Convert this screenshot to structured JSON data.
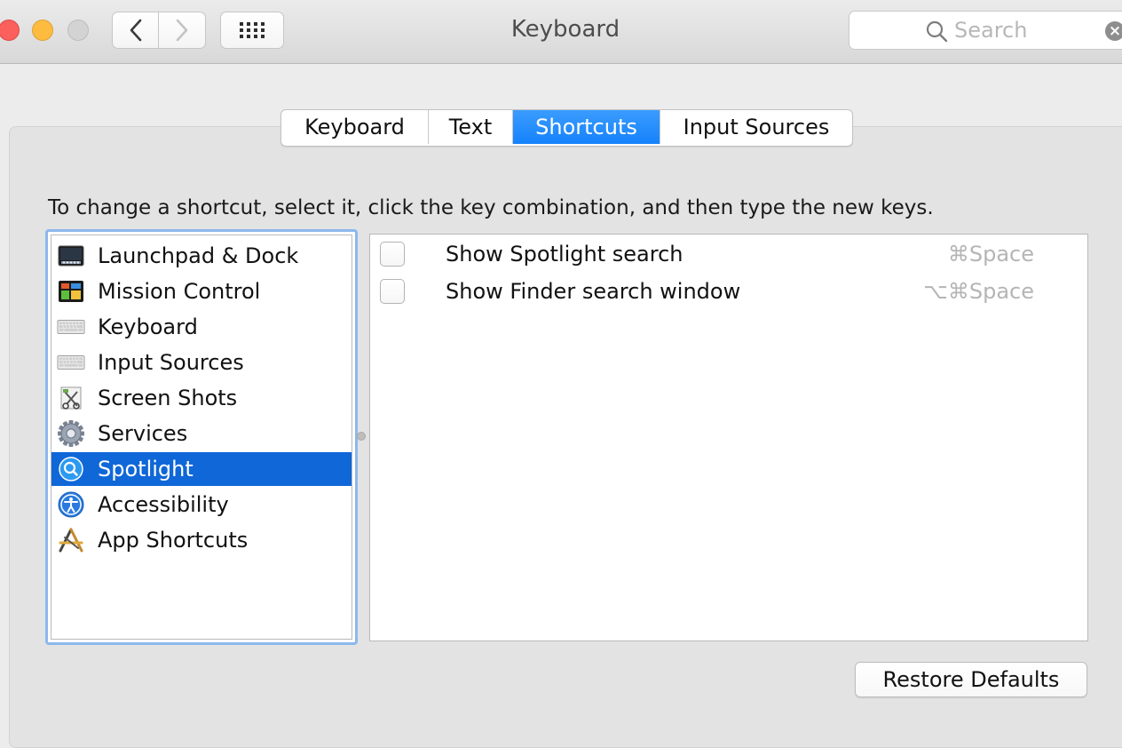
{
  "window": {
    "title": "Keyboard"
  },
  "toolbar": {
    "back_icon": "chevron-left-icon",
    "forward_icon": "chevron-right-icon",
    "show_all_icon": "grid-icon"
  },
  "search": {
    "placeholder": "Search",
    "value": "",
    "clear_symbol": "×"
  },
  "tabs": [
    {
      "label": "Keyboard",
      "active": false
    },
    {
      "label": "Text",
      "active": false
    },
    {
      "label": "Shortcuts",
      "active": true
    },
    {
      "label": "Input Sources",
      "active": false
    }
  ],
  "instruction": "To change a shortcut, select it, click the key combination, and then type the new keys.",
  "categories": [
    {
      "label": "Launchpad & Dock",
      "icon": "launchpad-dock-icon",
      "selected": false
    },
    {
      "label": "Mission Control",
      "icon": "mission-control-icon",
      "selected": false
    },
    {
      "label": "Keyboard",
      "icon": "keyboard-icon",
      "selected": false
    },
    {
      "label": "Input Sources",
      "icon": "keyboard-icon",
      "selected": false
    },
    {
      "label": "Screen Shots",
      "icon": "screenshot-icon",
      "selected": false
    },
    {
      "label": "Services",
      "icon": "gear-icon",
      "selected": false
    },
    {
      "label": "Spotlight",
      "icon": "spotlight-icon",
      "selected": true
    },
    {
      "label": "Accessibility",
      "icon": "accessibility-icon",
      "selected": false
    },
    {
      "label": "App Shortcuts",
      "icon": "app-shortcuts-icon",
      "selected": false
    }
  ],
  "shortcuts": [
    {
      "label": "Show Spotlight search",
      "key": "⌘Space",
      "checked": false
    },
    {
      "label": "Show Finder search window",
      "key": "⌥⌘Space",
      "checked": false
    }
  ],
  "restore_defaults_label": "Restore Defaults",
  "colors": {
    "accent": "#1582fb",
    "selection": "#0f67d8",
    "close": "#fc605c",
    "minimize": "#fdbc40"
  }
}
